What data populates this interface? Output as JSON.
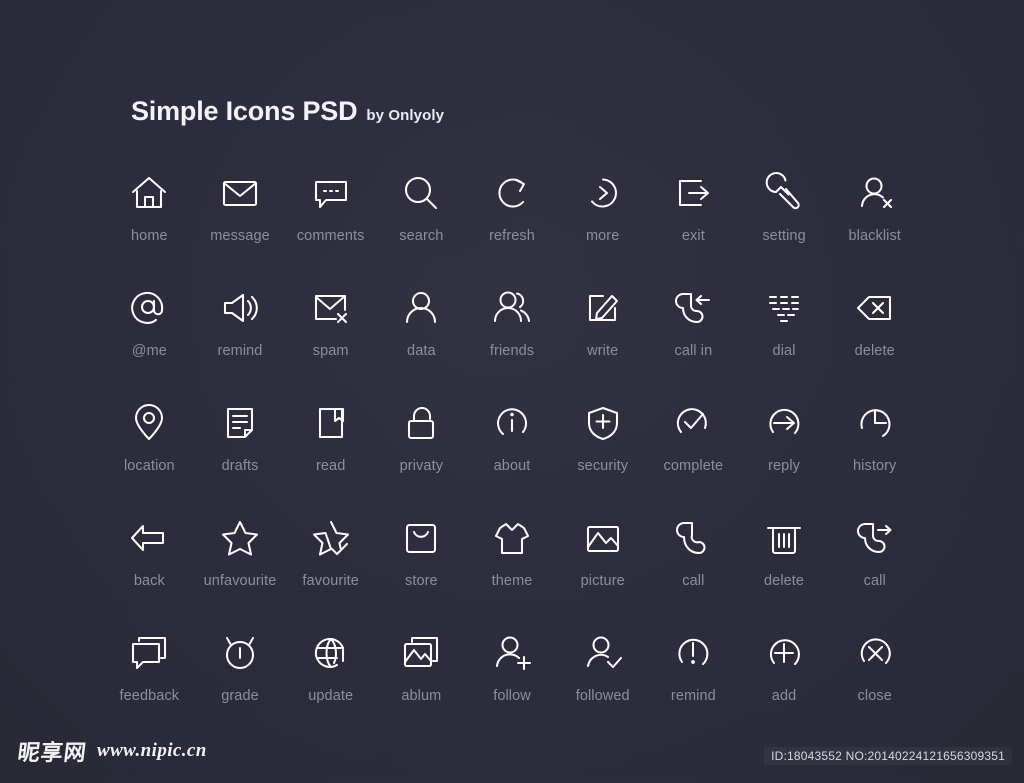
{
  "meta": {
    "background_color": "#2b2b3d",
    "icon_color": "#fcfcfe",
    "label_color": "#8d8d9d"
  },
  "header": {
    "title": "Simple Icons PSD",
    "byline": "by Onlyoly"
  },
  "footer": {
    "logo_cn": "昵享网",
    "site_url": "www.nipic.cn",
    "asset_id": "ID:18043552 NO:20140224121656309351"
  },
  "grid": {
    "columns": 9,
    "rows": [
      {
        "index": 1,
        "cells": [
          {
            "label": "home",
            "icon": "home-icon"
          },
          {
            "label": "message",
            "icon": "envelope-icon"
          },
          {
            "label": "comments",
            "icon": "comment-dots-icon"
          },
          {
            "label": "search",
            "icon": "magnifier-icon"
          },
          {
            "label": "refresh",
            "icon": "refresh-arrow-icon"
          },
          {
            "label": "more",
            "icon": "chevron-right-circle-icon"
          },
          {
            "label": "exit",
            "icon": "exit-arrow-box-icon"
          },
          {
            "label": "setting",
            "icon": "wrench-icon"
          },
          {
            "label": "blacklist",
            "icon": "person-x-icon"
          }
        ]
      },
      {
        "index": 2,
        "cells": [
          {
            "label": "@me",
            "icon": "at-sign-icon"
          },
          {
            "label": "remind",
            "icon": "speaker-icon"
          },
          {
            "label": "spam",
            "icon": "envelope-x-icon"
          },
          {
            "label": "data",
            "icon": "person-icon"
          },
          {
            "label": "friends",
            "icon": "two-people-icon"
          },
          {
            "label": "write",
            "icon": "pencil-square-icon"
          },
          {
            "label": "call in",
            "icon": "phone-incoming-icon"
          },
          {
            "label": "dial",
            "icon": "keypad-icon"
          },
          {
            "label": "delete",
            "icon": "backspace-x-icon"
          }
        ]
      },
      {
        "index": 3,
        "cells": [
          {
            "label": "location",
            "icon": "map-pin-icon"
          },
          {
            "label": "drafts",
            "icon": "document-lines-icon"
          },
          {
            "label": "read",
            "icon": "book-icon"
          },
          {
            "label": "privaty",
            "icon": "open-lock-icon"
          },
          {
            "label": "about",
            "icon": "info-circle-icon"
          },
          {
            "label": "security",
            "icon": "shield-plus-icon"
          },
          {
            "label": "complete",
            "icon": "check-circle-icon"
          },
          {
            "label": "reply",
            "icon": "arrow-right-circle-icon"
          },
          {
            "label": "history",
            "icon": "clock-icon"
          }
        ]
      },
      {
        "index": 4,
        "cells": [
          {
            "label": "back",
            "icon": "arrow-left-icon"
          },
          {
            "label": "unfavourite",
            "icon": "star-outline-icon"
          },
          {
            "label": "favourite",
            "icon": "star-check-icon"
          },
          {
            "label": "store",
            "icon": "shopping-bag-icon"
          },
          {
            "label": "theme",
            "icon": "tshirt-icon"
          },
          {
            "label": "picture",
            "icon": "image-icon"
          },
          {
            "label": "call",
            "icon": "phone-handset-icon"
          },
          {
            "label": "delete",
            "icon": "trash-icon"
          },
          {
            "label": "call",
            "icon": "phone-outgoing-icon"
          }
        ]
      },
      {
        "index": 5,
        "cells": [
          {
            "label": "feedback",
            "icon": "chat-bubbles-icon"
          },
          {
            "label": "grade",
            "icon": "timer-gauge-icon"
          },
          {
            "label": "update",
            "icon": "globe-icon"
          },
          {
            "label": "ablum",
            "icon": "image-stack-icon"
          },
          {
            "label": "follow",
            "icon": "person-plus-icon"
          },
          {
            "label": "followed",
            "icon": "person-check-icon"
          },
          {
            "label": "remind",
            "icon": "exclamation-circle-icon"
          },
          {
            "label": "add",
            "icon": "plus-circle-icon"
          },
          {
            "label": "close",
            "icon": "x-circle-icon"
          }
        ]
      }
    ]
  }
}
